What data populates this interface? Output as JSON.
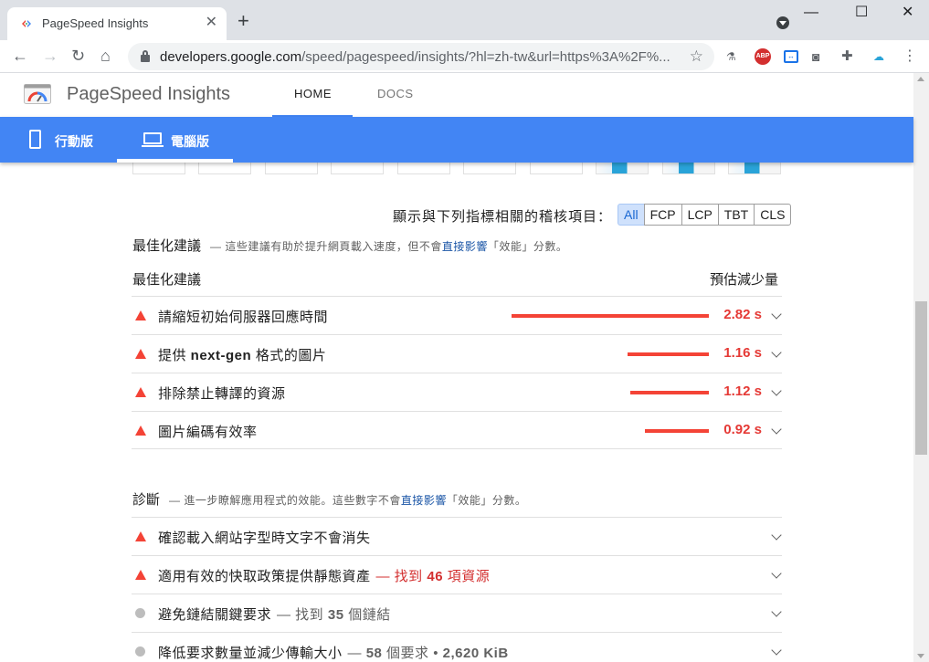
{
  "browser": {
    "tab_title": "PageSpeed Insights",
    "new_tab": "+",
    "url_host": "developers.google.com",
    "url_path": "/speed/pagespeed/insights/?hl=zh-tw&url=https%3A%2F%...",
    "window_min": "—",
    "window_max": "☐",
    "window_close": "✕",
    "ext_abp": "ABP"
  },
  "header": {
    "title": "PageSpeed Insights",
    "nav": [
      "HOME",
      "DOCS"
    ]
  },
  "device_tabs": [
    "行動版",
    "電腦版"
  ],
  "filter": {
    "label": "顯示與下列指標相關的稽核項目：",
    "chips": [
      "All",
      "FCP",
      "LCP",
      "TBT",
      "CLS"
    ],
    "active": "All"
  },
  "opportunities": {
    "title": "最佳化建議",
    "desc_prefix": "— 這些建議有助於提升網頁載入速度，但不會",
    "desc_link": "直接影響",
    "desc_suffix": "「效能」分數。",
    "col_left": "最佳化建議",
    "col_right": "預估減少量",
    "items": [
      {
        "title": "請縮短初始伺服器回應時間",
        "value": "2.82 s",
        "seconds": 2.82
      },
      {
        "title_pre": "提供 ",
        "title_bold": "next-gen",
        "title_post": " 格式的圖片",
        "value": "1.16 s",
        "seconds": 1.16
      },
      {
        "title": "排除禁止轉譯的資源",
        "value": "1.12 s",
        "seconds": 1.12
      },
      {
        "title": "圖片編碼有效率",
        "value": "0.92 s",
        "seconds": 0.92
      }
    ]
  },
  "diagnostics": {
    "title": "診斷",
    "desc_prefix": "— 進一步瞭解應用程式的效能。這些數字不會",
    "desc_link": "直接影響",
    "desc_suffix": "「效能」分數。",
    "items": [
      {
        "status": "fail",
        "title": "確認載入網站字型時文字不會消失"
      },
      {
        "status": "fail",
        "title": "適用有效的快取政策提供靜態資產",
        "extra_pre": "— 找到 ",
        "extra_bold": "46",
        "extra_post": " 項資源"
      },
      {
        "status": "info",
        "title": "避免鏈結關鍵要求",
        "extra_pre": "— 找到 ",
        "extra_bold": "35",
        "extra_post": " 個鏈結"
      },
      {
        "status": "info",
        "title": "降低要求數量並減少傳輸大小",
        "extra_pre": "— ",
        "extra_bold": "58",
        "extra_post": " 個要求 • ",
        "extra_bold2": "2,620 KiB"
      }
    ]
  },
  "colors": {
    "accent_blue": "#4285f4",
    "fail_red": "#f44336",
    "value_red": "#e53935",
    "chip_active_bg": "#cfe1fc"
  }
}
